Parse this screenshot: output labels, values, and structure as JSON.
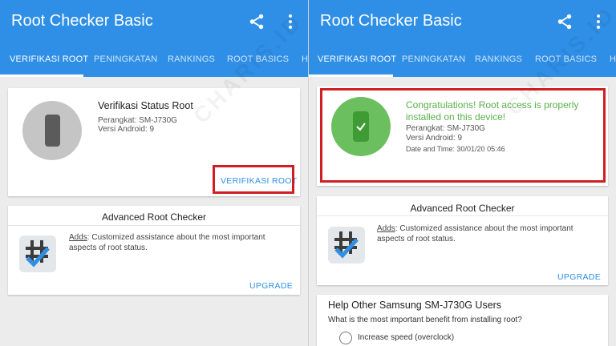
{
  "left": {
    "app_title": "Root Checker Basic",
    "tabs": [
      "VERIFIKASI ROOT",
      "PENINGKATAN",
      "RANKINGS",
      "ROOT BASICS",
      "H"
    ],
    "status_card": {
      "title": "Verifikasi Status Root",
      "device": "Perangkat: SM-J730G",
      "android": "Versi Android: 9",
      "button": "VERIFIKASI ROOT"
    },
    "advanced": {
      "title": "Advanced Root Checker",
      "adds": "Adds",
      "text": ": Customized assistance about the most important aspects of root status.",
      "button": "UPGRADE"
    }
  },
  "right": {
    "app_title": "Root Checker Basic",
    "tabs": [
      "VERIFIKASI ROOT",
      "PENINGKATAN",
      "RANKINGS",
      "ROOT BASICS",
      "H"
    ],
    "result_card": {
      "message": "Congratulations! Root access is properly installed on this device!",
      "device": "Perangkat: SM-J730G",
      "android": "Versi Android: 9",
      "datetime": "Date and Time: 30/01/20 05:46"
    },
    "advanced": {
      "title": "Advanced Root Checker",
      "adds": "Adds",
      "text": ": Customized assistance about the most important aspects of root status.",
      "button": "UPGRADE"
    },
    "help": {
      "title": "Help Other Samsung SM-J730G Users",
      "question": "What is the most important benefit from installing root?",
      "option1": "Increase speed (overclock)"
    }
  },
  "watermark": "CHARIS.ID",
  "colors": {
    "appbar": "#2f8fe6",
    "success": "#58b04a",
    "highlight": "#d01f23"
  },
  "icons": [
    "share-icon",
    "more-vert-icon",
    "phone-icon",
    "check-phone-icon",
    "root-checker-app-icon"
  ]
}
